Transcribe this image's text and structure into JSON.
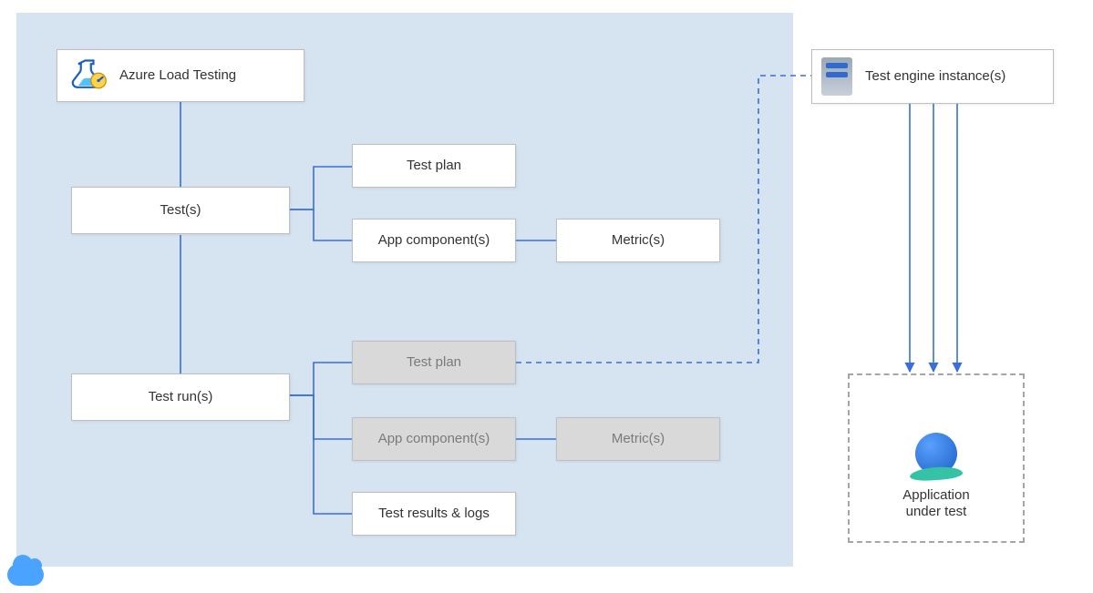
{
  "nodes": {
    "azure_load_testing": "Azure Load Testing",
    "tests": "Test(s)",
    "test_runs": "Test run(s)",
    "test_plan_a": "Test plan",
    "app_components_a": "App component(s)",
    "metrics_a": "Metric(s)",
    "test_plan_b": "Test plan",
    "app_components_b": "App component(s)",
    "metrics_b": "Metric(s)",
    "test_results": "Test results & logs",
    "test_engine": "Test engine instance(s)",
    "app_under_test_l1": "Application",
    "app_under_test_l2": "under test"
  },
  "icons": {
    "alt": "azure-load-testing-icon",
    "server": "server-icon",
    "globe": "globe-icon",
    "cloud": "cloud-icon"
  },
  "colors": {
    "panel_blue": "#d6e4f2",
    "connector_blue": "#3a6fd8",
    "box_grey": "#d9d9d9"
  }
}
